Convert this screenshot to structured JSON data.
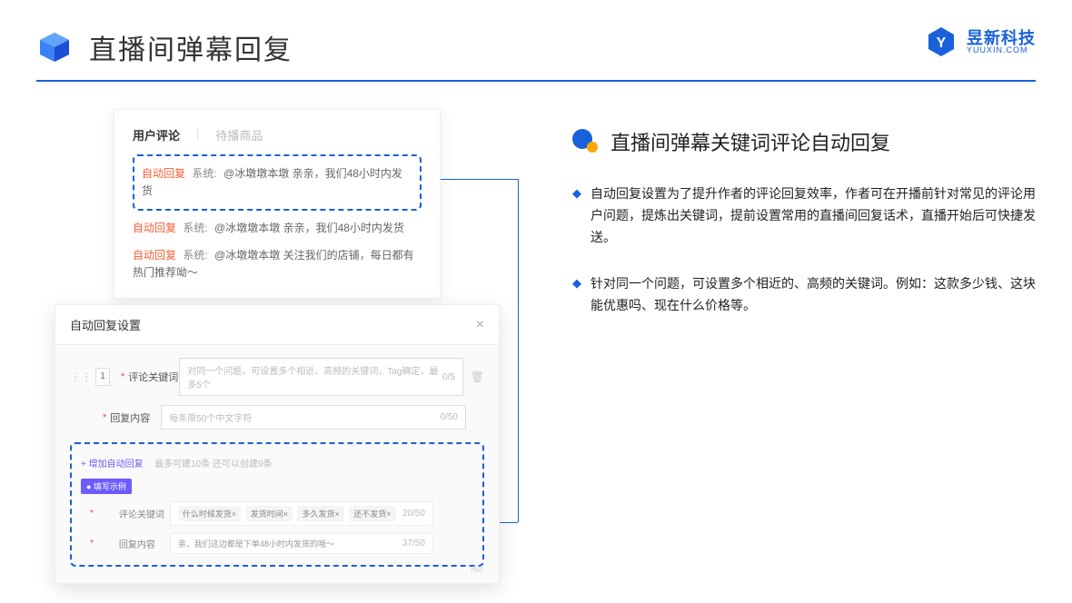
{
  "header": {
    "title": "直播间弹幕回复"
  },
  "brand": {
    "cn": "昱新科技",
    "en": "YUUXIN.COM"
  },
  "card1": {
    "tab_active": "用户评论",
    "tab_inactive": "待播商品",
    "tag_auto": "自动回复",
    "tag_sys": "系统:",
    "line1": "@冰墩墩本墩 亲亲，我们48小时内发货",
    "line2": "@冰墩墩本墩 亲亲，我们48小时内发货",
    "line3": "@冰墩墩本墩 关注我们的店铺，每日都有热门推荐呦～"
  },
  "card2": {
    "title": "自动回复设置",
    "idx": "1",
    "lbl_kw": "评论关键词",
    "ph_kw": "对同一个问题，可设置多个相近、高频的关键词，Tag确定，最多5个",
    "cnt_kw": "0/5",
    "lbl_rc": "回复内容",
    "ph_rc": "每条限50个中文字符",
    "cnt_rc": "0/50",
    "add": "+ 增加自动回复",
    "add_hint": "最多可建10条 还可以创建9条",
    "badge": "● 填写示例",
    "ex_kw_lbl": "评论关键词",
    "ex_chip1": "什么时候发货×",
    "ex_chip2": "发货时间×",
    "ex_chip3": "多久发货×",
    "ex_chip4": "还不发货×",
    "ex_kw_cnt": "20/50",
    "ex_rc_lbl": "回复内容",
    "ex_rc_val": "亲，我们这边都是下单48小时内发货的哦～",
    "ex_rc_cnt": "37/50",
    "bottom_cnt": "/50"
  },
  "right": {
    "title": "直播间弹幕关键词评论自动回复",
    "b1": "自动回复设置为了提升作者的评论回复效率，作者可在开播前针对常见的评论用户问题，提炼出关键词，提前设置常用的直播间回复话术，直播开始后可快捷发送。",
    "b2": "针对同一个问题，可设置多个相近的、高频的关键词。例如：这款多少钱、这块能优惠吗、现在什么价格等。"
  }
}
